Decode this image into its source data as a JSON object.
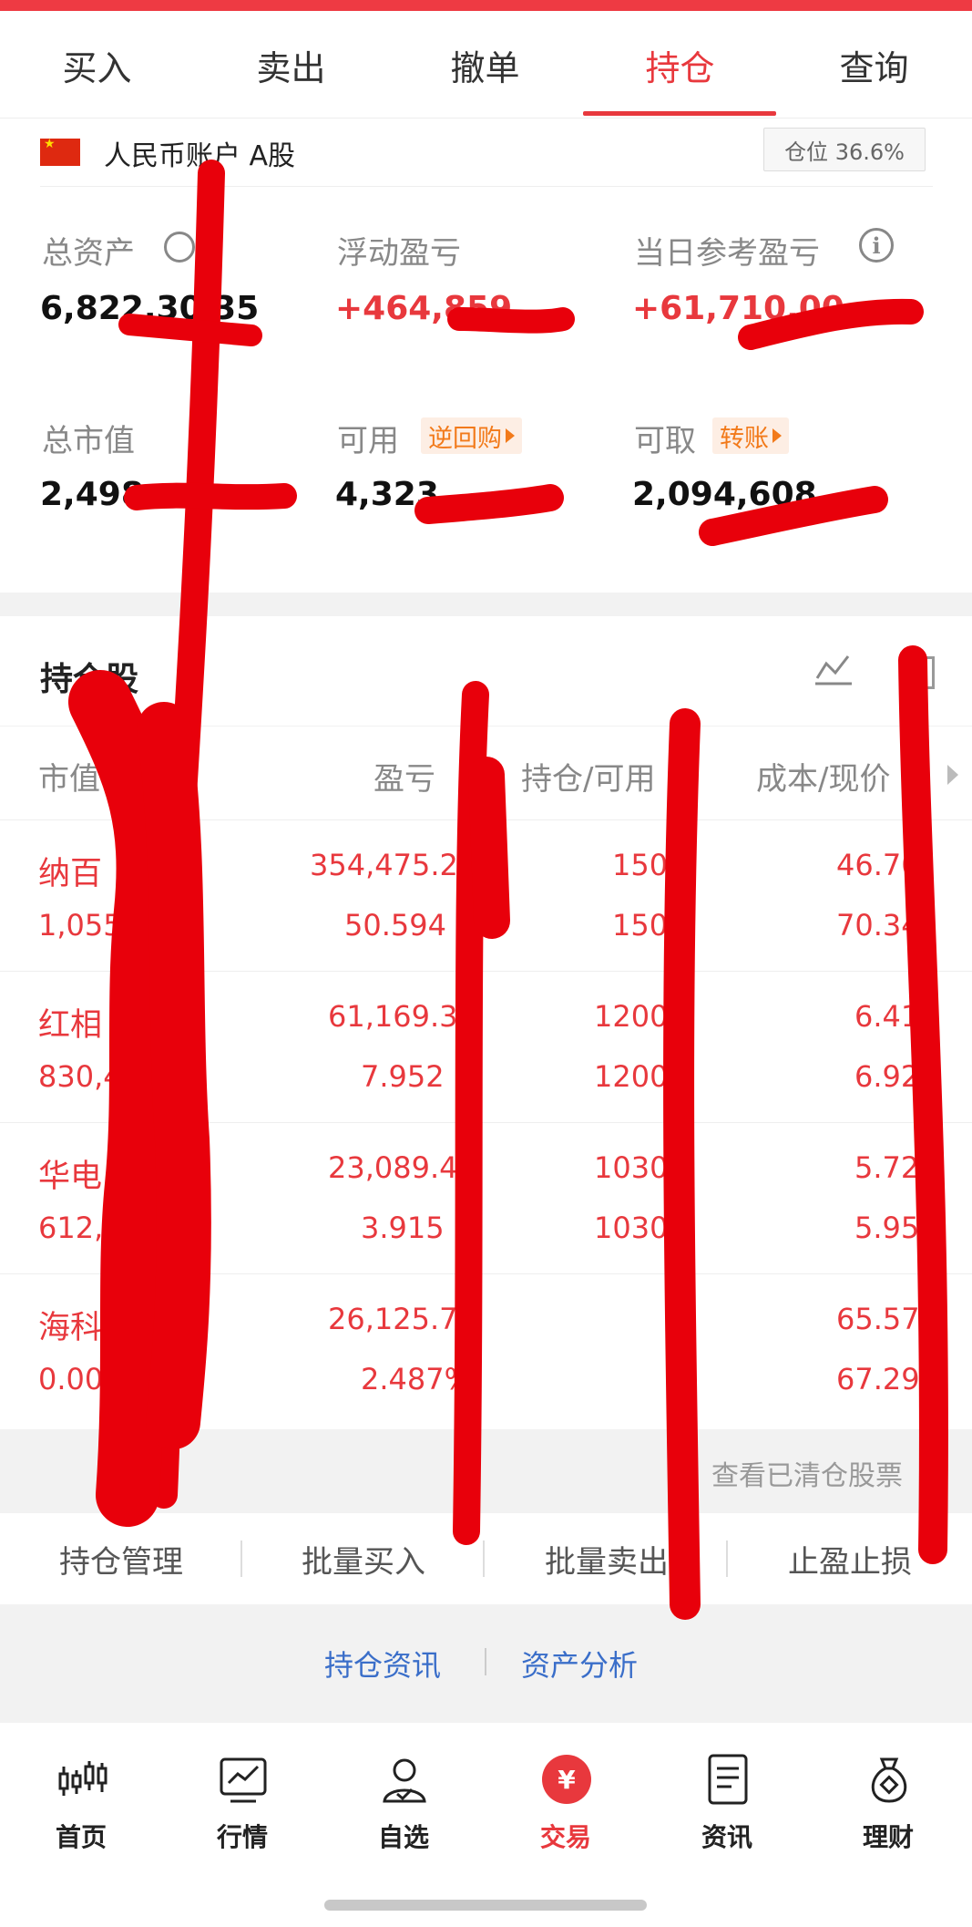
{
  "tabs": [
    {
      "label": "买入"
    },
    {
      "label": "卖出"
    },
    {
      "label": "撤单"
    },
    {
      "label": "持仓",
      "active": true
    },
    {
      "label": "查询"
    }
  ],
  "account": {
    "name": "人民币账户 A股",
    "position_ratio": "仓位 36.6%",
    "metrics": {
      "total_assets": {
        "label": "总资产",
        "value": "6,822,30 35"
      },
      "floating_pnl": {
        "label": "浮动盈亏",
        "value": "+464,859"
      },
      "daily_pnl": {
        "label": "当日参考盈亏",
        "value": "+61,710.00"
      },
      "market_value": {
        "label": "总市值",
        "value": "2,498"
      },
      "available": {
        "label": "可用",
        "value": "4,323",
        "tag": "逆回购"
      },
      "withdrawable": {
        "label": "可取",
        "value": "2,094,608",
        "tag": "转账"
      }
    }
  },
  "holdings": {
    "title": "持仓股",
    "columns": [
      "市值",
      "盈亏",
      "持仓/可用",
      "成本/现价"
    ],
    "rows": [
      {
        "name": "纳百",
        "market_value": "1,055",
        "pnl": "354,475.2",
        "pnl_pct": "50.594",
        "hold": "150",
        "avail": "150",
        "cost": "46.70",
        "price": "70.34"
      },
      {
        "name": "红相",
        "market_value": "830,40",
        "pnl": "61,169.3",
        "pnl_pct": "7.952",
        "hold": "1200",
        "avail": "1200",
        "cost": "6.41",
        "price": "6.92"
      },
      {
        "name": "华电",
        "market_value": "612,8",
        "pnl": "23,089.4",
        "pnl_pct": "3.915",
        "hold": "1030",
        "avail": "1030",
        "cost": "5.72",
        "price": "5.95"
      },
      {
        "name": "海科",
        "market_value": "0.00",
        "pnl": "26,125.7",
        "pnl_pct": "2.487%",
        "hold": "",
        "avail": "",
        "cost": "65.57",
        "price": "67.29"
      }
    ],
    "view_cleared": "查看已清仓股票"
  },
  "actions": [
    "持仓管理",
    "批量买入",
    "批量卖出",
    "止盈止损"
  ],
  "links": [
    "持仓资讯",
    "资产分析"
  ],
  "bottom_nav": [
    {
      "label": "首页",
      "icon": "candlestick-icon"
    },
    {
      "label": "行情",
      "icon": "chart-monitor-icon"
    },
    {
      "label": "自选",
      "icon": "user-check-icon"
    },
    {
      "label": "交易",
      "icon": "yuan-coin-icon",
      "active": true
    },
    {
      "label": "资讯",
      "icon": "document-icon"
    },
    {
      "label": "理财",
      "icon": "money-bag-icon"
    }
  ],
  "colors": {
    "accent": "#e8383d",
    "link": "#3a6ec9",
    "tag": "#f27a1a",
    "scribble": "#e8000b"
  }
}
